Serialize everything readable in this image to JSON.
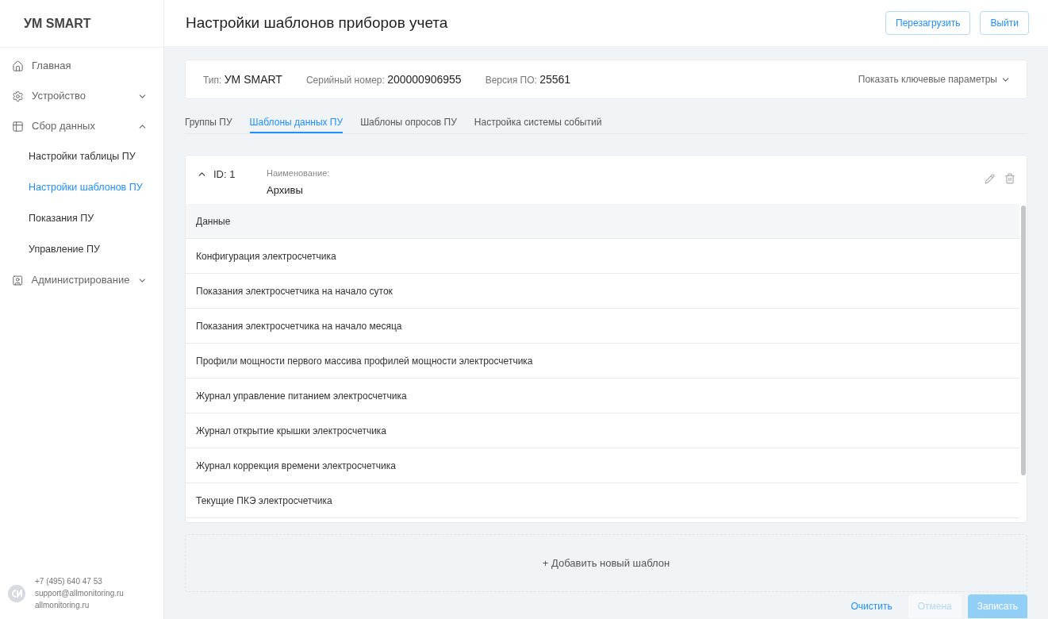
{
  "sidebar": {
    "brand": "УМ SMART",
    "items": [
      {
        "label": "Главная"
      },
      {
        "label": "Устройство",
        "expanded": false
      },
      {
        "label": "Сбор данных",
        "expanded": true,
        "children": [
          {
            "label": "Настройки таблицы ПУ",
            "selected": false
          },
          {
            "label": "Настройки шаблонов ПУ",
            "selected": true
          },
          {
            "label": "Показания ПУ",
            "selected": false
          },
          {
            "label": "Управление ПУ",
            "selected": false
          }
        ]
      },
      {
        "label": "Администрирование",
        "expanded": false
      }
    ],
    "footer": {
      "phone": "+7 (495) 640 47 53",
      "email": "support@allmonitoring.ru",
      "site": "allmonitoring.ru"
    }
  },
  "header": {
    "title": "Настройки шаблонов приборов учета",
    "buttons": [
      "Перезагрузить",
      "Выйти"
    ]
  },
  "device": {
    "type_label": "Тип:",
    "type": "УМ SMART",
    "serial_label": "Серийный номер:",
    "serial": "200000906955",
    "version_label": "Версия ПО:",
    "version": "25561",
    "toggle": "Показать ключевые параметры"
  },
  "tabs": [
    {
      "label": "Группы ПУ",
      "selected": false
    },
    {
      "label": "Шаблоны данных ПУ",
      "selected": true
    },
    {
      "label": "Шаблоны опросов ПУ",
      "selected": false
    },
    {
      "label": "Настройка системы событий",
      "selected": false
    }
  ],
  "template": {
    "id": "ID: 1",
    "expanded": true,
    "name_label": "Наименование:",
    "name": "Архивы",
    "column": "Данные",
    "rows": [
      "Конфигурация электросчетчика",
      "Показания электросчетчика на начало суток",
      "Показания электросчетчика на начало месяца",
      "Профили мощности первого массива профилей мощности электросчетчика",
      "Журнал управление питанием электросчетчика",
      "Журнал открытие крышки электросчетчика",
      "Журнал коррекция времени электросчетчика",
      "Текущие ПКЭ электросчетчика"
    ]
  },
  "add_template": "+ Добавить новый шаблон",
  "actions": [
    {
      "label": "Очистить",
      "kind": "link"
    },
    {
      "label": "Отмена",
      "kind": "secondary",
      "disabled": true
    },
    {
      "label": "Записать",
      "kind": "primary",
      "disabled": true
    }
  ]
}
